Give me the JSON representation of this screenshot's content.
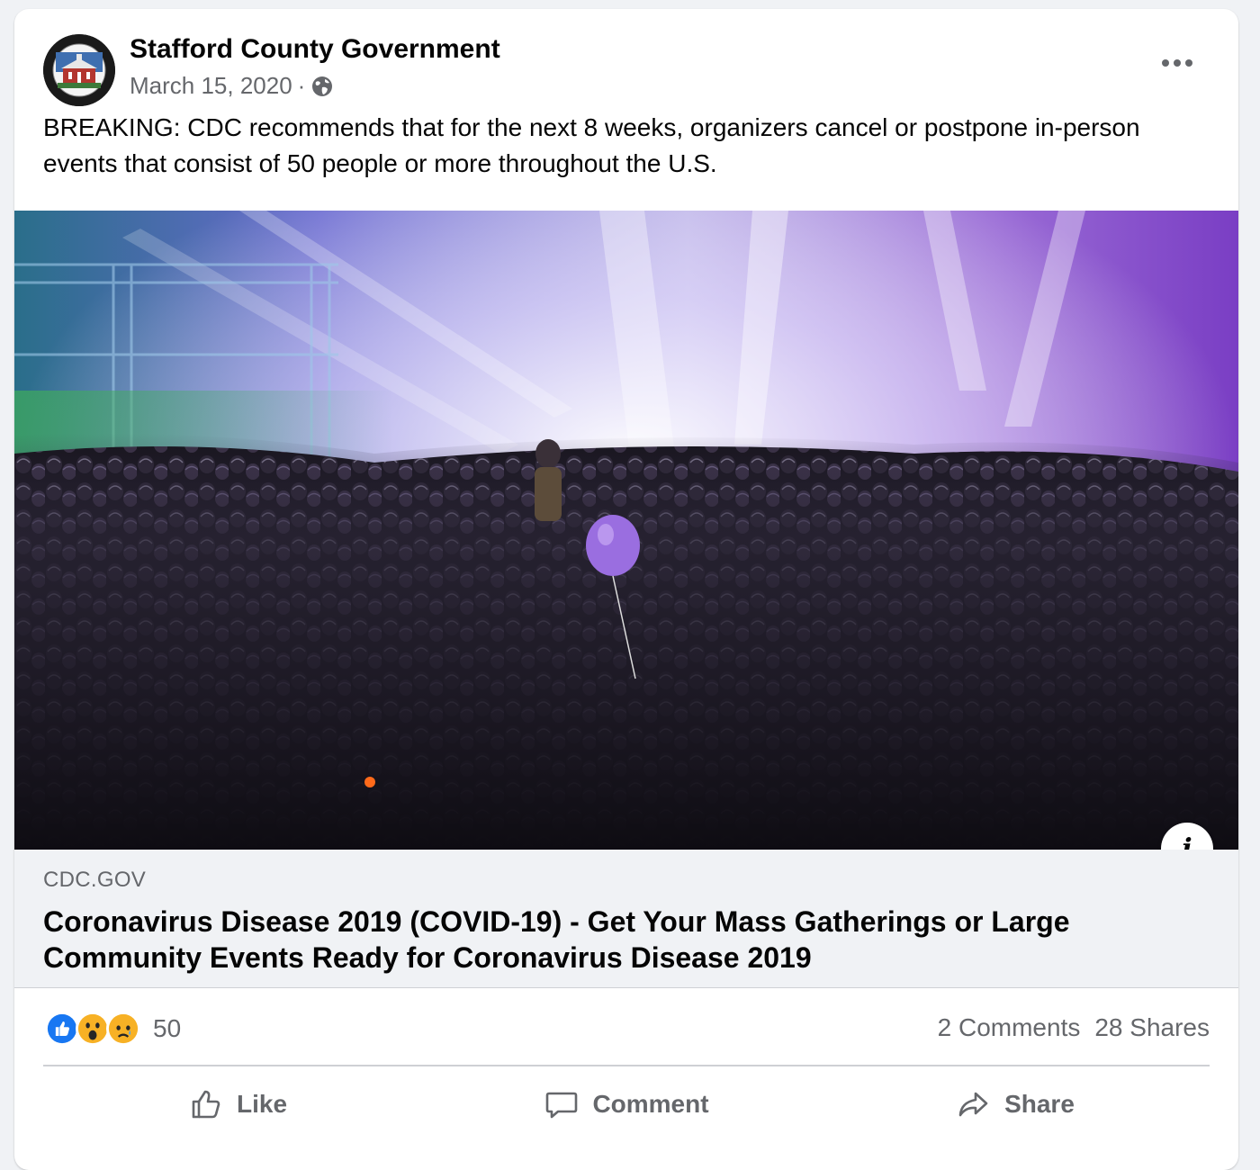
{
  "post": {
    "author": "Stafford County Government",
    "date": "March 15, 2020",
    "separator": "·",
    "audience_icon": "globe-icon",
    "message": "BREAKING: CDC recommends that for the next 8 weeks, organizers cancel or postpone in-person events that consist of 50 people or more throughout the U.S."
  },
  "link": {
    "domain": "CDC.GOV",
    "title": "Coronavirus Disease 2019 (COVID-19) - Get Your Mass Gatherings or Large Community Events Ready for Coronavirus Disease 2019",
    "info_label": "i"
  },
  "stats": {
    "reaction_icons": [
      "like-reaction-icon",
      "wow-reaction-icon",
      "sad-reaction-icon"
    ],
    "reaction_count": "50",
    "comments": "2 Comments",
    "shares": "28 Shares"
  },
  "actions": {
    "like": "Like",
    "comment": "Comment",
    "share": "Share"
  },
  "colors": {
    "secondary_text": "#65676b",
    "like_blue": "#1877f2",
    "card_bg": "#ffffff",
    "page_bg": "#f0f2f5"
  }
}
